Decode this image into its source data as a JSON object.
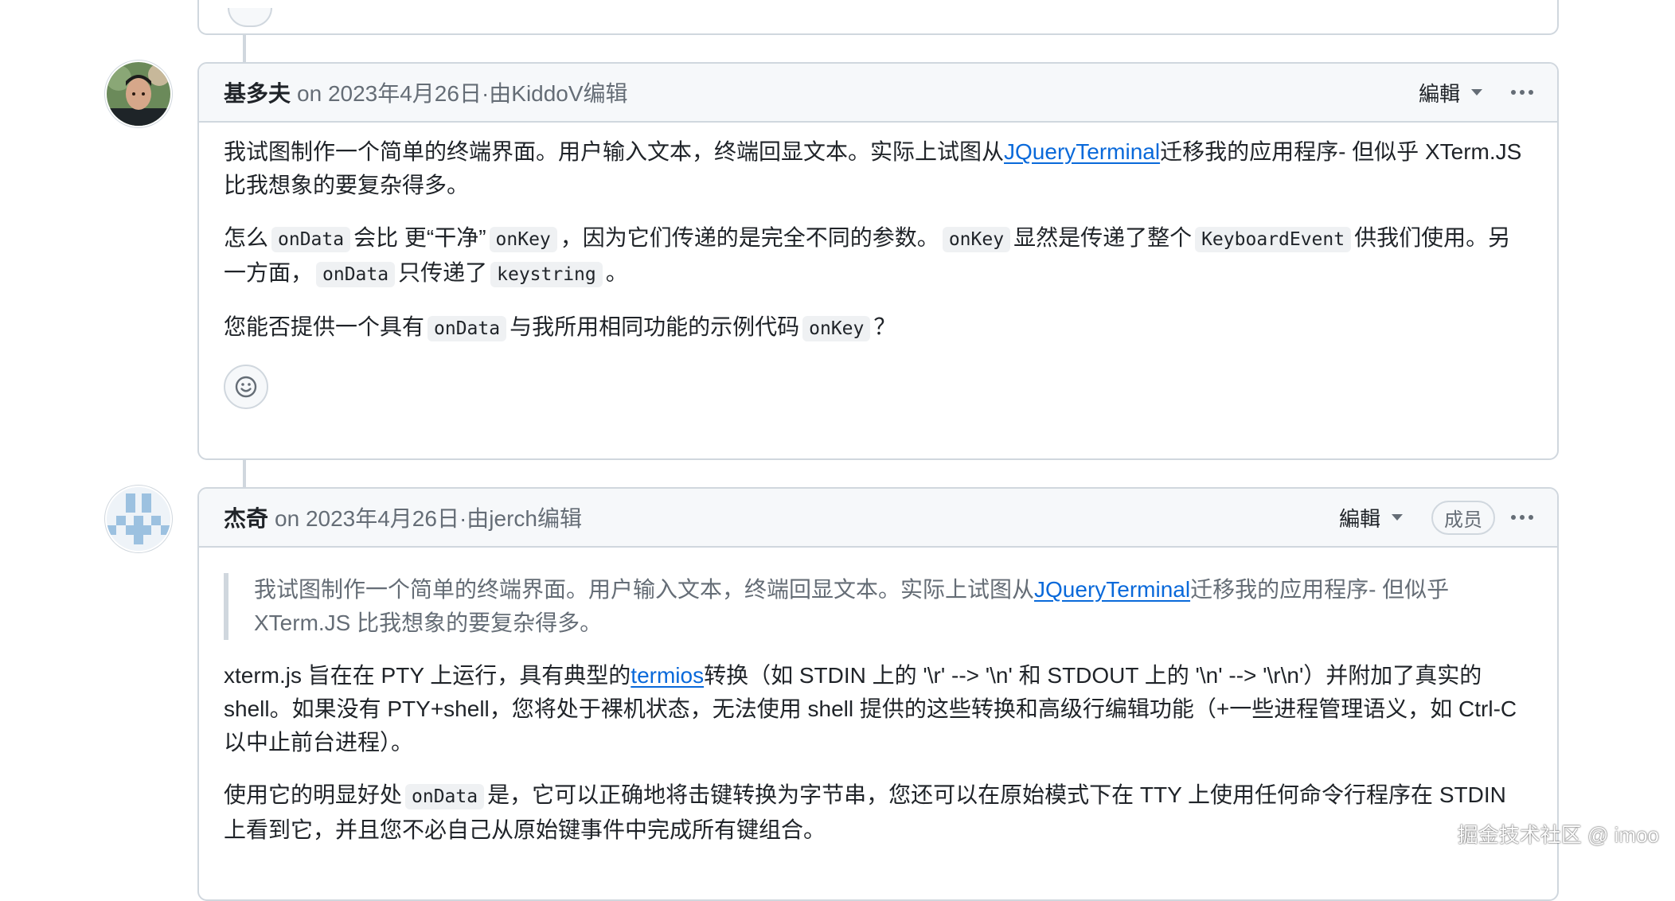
{
  "comments": [
    {
      "author": "基多夫",
      "meta": "on 2023年4月26日·由KiddoV编辑",
      "edit_label": "編輯",
      "paragraphs": [
        {
          "text_1": "我试图制作一个简单的终端界面。用户输入文本，终端回显文本。实际上试图从",
          "link": "JQueryTerminal",
          "text_2": "迁移我的应用程序- 但似乎 XTerm.JS 比我想象的要复杂得多。"
        },
        {
          "t1": "怎么",
          "c1": "onData",
          "t2": "会比 更“干净”",
          "c2": "onKey",
          "t3": "，因为它们传递的是完全不同的参数。",
          "c3": "onKey",
          "t4": "显然是传递了整个",
          "c4": "KeyboardEvent",
          "t5": "供我们使用。另一方面，",
          "c5": "onData",
          "t6": "只传递了",
          "c6": "keystring",
          "t7": "。"
        },
        {
          "t1": "您能否提供一个具有",
          "c1": "onData",
          "t2": "与我所用相同功能的示例代码",
          "c2": "onKey",
          "t3": "？"
        }
      ]
    },
    {
      "author": "杰奇",
      "meta": "on 2023年4月26日·由jerch编辑",
      "edit_label": "編輯",
      "badge": "成员",
      "quote": {
        "text_1": "我试图制作一个简单的终端界面。用户输入文本，终端回显文本。实际上试图从",
        "link": "JQueryTerminal",
        "text_2": "迁移我的应用程序- 但似乎 XTerm.JS 比我想象的要复杂得多。"
      },
      "paragraphs": [
        {
          "text_1": "xterm.js 旨在在 PTY 上运行，具有典型的",
          "link": "termios",
          "text_2": "转换（如 STDIN 上的 '\\r' --> '\\n' 和 STDOUT 上的 '\\n' --> '\\r\\n'）并附加了真实的 shell。如果没有 PTY+shell，您将处于裸机状态，无法使用 shell 提供的这些转换和高级行编辑功能（+一些进程管理语义，如 Ctrl-C 以中止前台进程）。"
        },
        {
          "t1": "使用它的明显好处",
          "c1": "onData",
          "t2": "是，它可以正确地将击键转换为字节串，您还可以在原始模式下在 TTY 上使用任何命令行程序在 STDIN 上看到它，并且您不必自己从原始键事件中完成所有键组合。"
        }
      ]
    }
  ],
  "watermark": "掘金技术社区 @ imoo",
  "icons": {
    "reaction": "smiley-icon",
    "more": "kebab-horizontal-icon",
    "dropdown": "triangle-down-icon"
  },
  "colors": {
    "link": "#0969da",
    "border": "#d0d7de",
    "header_bg": "#f6f8fa",
    "muted": "#656d76"
  }
}
